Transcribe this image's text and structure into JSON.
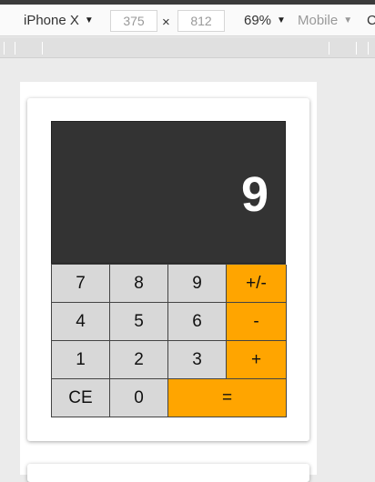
{
  "toolbar": {
    "device": "iPhone X",
    "width": "375",
    "times": "×",
    "height": "812",
    "zoom": "69%",
    "mode": "Mobile",
    "extra": "C",
    "caret": "▼"
  },
  "calculator": {
    "display": "9",
    "keys": [
      {
        "label": "7",
        "type": "digit"
      },
      {
        "label": "8",
        "type": "digit"
      },
      {
        "label": "9",
        "type": "digit"
      },
      {
        "label": "+/-",
        "type": "op"
      },
      {
        "label": "4",
        "type": "digit"
      },
      {
        "label": "5",
        "type": "digit"
      },
      {
        "label": "6",
        "type": "digit"
      },
      {
        "label": "-",
        "type": "op"
      },
      {
        "label": "1",
        "type": "digit"
      },
      {
        "label": "2",
        "type": "digit"
      },
      {
        "label": "3",
        "type": "digit"
      },
      {
        "label": "+",
        "type": "op"
      },
      {
        "label": "CE",
        "type": "digit"
      },
      {
        "label": "0",
        "type": "digit"
      },
      {
        "label": "=",
        "type": "op"
      }
    ]
  },
  "colors": {
    "display_bg": "#333333",
    "key_bg": "#d8d8d8",
    "operator_bg": "#ffa500"
  }
}
